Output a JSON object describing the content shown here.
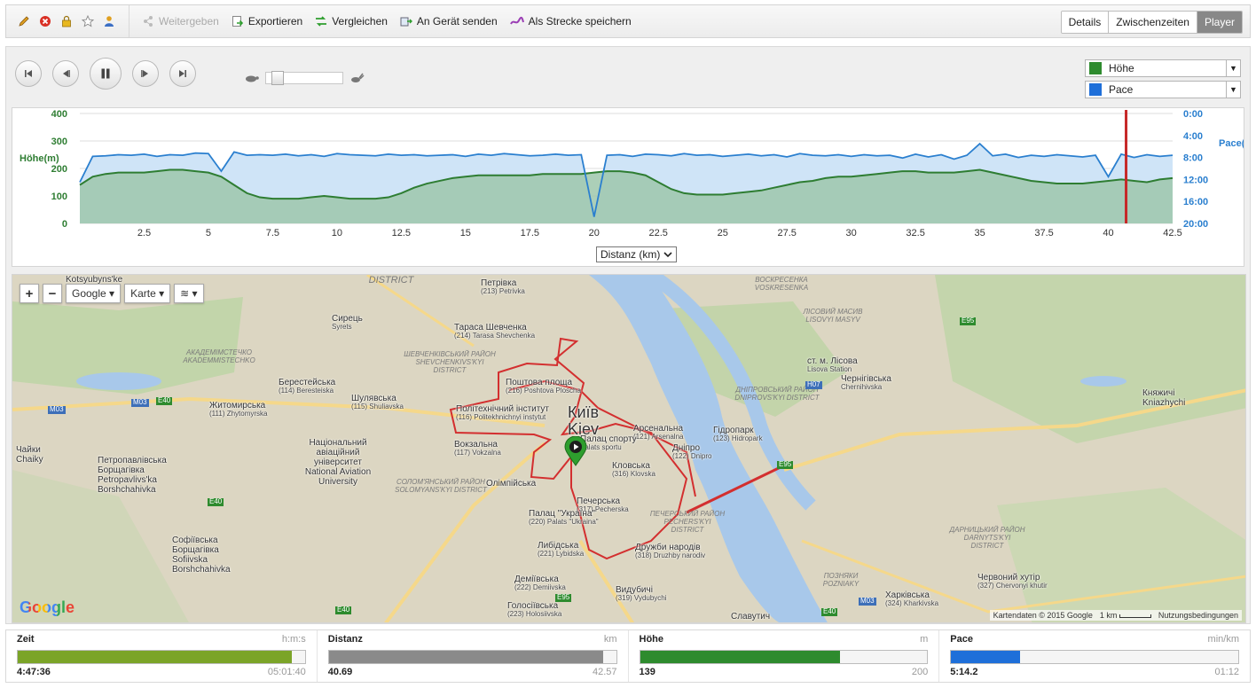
{
  "toolbar": {
    "icons": [
      "pencil-icon",
      "delete-icon",
      "lock-icon",
      "star-icon",
      "person-icon"
    ],
    "actions": [
      {
        "label": "Weitergeben",
        "icon": "share-icon",
        "enabled": false
      },
      {
        "label": "Exportieren",
        "icon": "export-icon",
        "enabled": true
      },
      {
        "label": "Vergleichen",
        "icon": "compare-icon",
        "enabled": true
      },
      {
        "label": "An Gerät senden",
        "icon": "send-device-icon",
        "enabled": true
      },
      {
        "label": "Als Strecke speichern",
        "icon": "save-course-icon",
        "enabled": true
      }
    ],
    "views": [
      {
        "label": "Details",
        "active": false
      },
      {
        "label": "Zwischenzeiten",
        "active": false
      },
      {
        "label": "Player",
        "active": true
      }
    ]
  },
  "player": {
    "buttons": [
      "skip-start-icon",
      "step-back-icon",
      "pause-icon",
      "step-forward-icon",
      "skip-end-icon"
    ],
    "speed_slow_icon": "turtle-icon",
    "speed_fast_icon": "rabbit-icon"
  },
  "series_selects": [
    {
      "label": "Höhe",
      "color": "#2e8b2e"
    },
    {
      "label": "Pace",
      "color": "#1e6fd9"
    }
  ],
  "chart_data": {
    "type": "area",
    "x": [
      0,
      0.5,
      1,
      1.5,
      2,
      2.5,
      3,
      3.5,
      4,
      4.5,
      5,
      5.5,
      6,
      6.5,
      7,
      7.5,
      8,
      8.5,
      9,
      9.5,
      10,
      10.5,
      11,
      11.5,
      12,
      12.5,
      13,
      13.5,
      14,
      14.5,
      15,
      15.5,
      16,
      16.5,
      17,
      17.5,
      18,
      18.5,
      19,
      19.5,
      20,
      20.5,
      21,
      21.5,
      22,
      22.5,
      23,
      23.5,
      24,
      24.5,
      25,
      25.5,
      26,
      26.5,
      27,
      27.5,
      28,
      28.5,
      29,
      29.5,
      30,
      30.5,
      31,
      31.5,
      32,
      32.5,
      33,
      33.5,
      34,
      34.5,
      35,
      35.5,
      36,
      36.5,
      37,
      37.5,
      38,
      38.5,
      39,
      39.5,
      40,
      40.5,
      41,
      41.5,
      42,
      42.5
    ],
    "xlim": [
      0,
      42.5
    ],
    "xticks": [
      "2.5",
      "5",
      "7.5",
      "10",
      "12.5",
      "15",
      "17.5",
      "20",
      "22.5",
      "25",
      "27.5",
      "30",
      "32.5",
      "35",
      "37.5",
      "40",
      "42.5"
    ],
    "xlabel": "Distanz (km)",
    "left_axis": {
      "label": "Höhe(m)",
      "ylim": [
        0,
        400
      ],
      "ticks": [
        "0",
        "100",
        "200",
        "300",
        "400"
      ]
    },
    "right_axis": {
      "label": "Pace(",
      "ticks": [
        "0:00",
        "4:00",
        "8:00",
        "12:00",
        "16:00",
        "20:00"
      ],
      "ylim": [
        0,
        20
      ]
    },
    "series": [
      {
        "name": "Höhe",
        "color": "#2e7d32",
        "fill": "#9dc7ab",
        "axis": "left",
        "values": [
          140,
          170,
          180,
          185,
          185,
          185,
          190,
          195,
          195,
          190,
          185,
          170,
          140,
          110,
          95,
          90,
          90,
          90,
          95,
          100,
          95,
          90,
          90,
          90,
          95,
          110,
          130,
          145,
          155,
          165,
          170,
          175,
          175,
          175,
          175,
          175,
          180,
          180,
          180,
          180,
          185,
          190,
          190,
          185,
          175,
          150,
          125,
          110,
          105,
          105,
          105,
          110,
          115,
          120,
          130,
          140,
          150,
          155,
          165,
          170,
          170,
          175,
          180,
          185,
          190,
          190,
          185,
          185,
          185,
          190,
          195,
          185,
          175,
          165,
          155,
          150,
          145,
          145,
          145,
          150,
          155,
          160,
          155,
          150,
          160,
          165
        ]
      },
      {
        "name": "Pace",
        "color": "#2a7fcf",
        "fill": "#cfe4f7",
        "axis": "right",
        "values": [
          12.5,
          7.8,
          7.7,
          7.5,
          7.6,
          7.4,
          7.8,
          7.5,
          7.6,
          7.2,
          7.3,
          10.5,
          7.0,
          7.6,
          7.5,
          7.6,
          7.4,
          7.7,
          7.5,
          7.8,
          7.3,
          7.5,
          7.6,
          7.7,
          7.4,
          7.6,
          7.5,
          7.7,
          7.6,
          7.5,
          7.8,
          7.4,
          7.6,
          7.3,
          7.5,
          7.7,
          7.6,
          7.4,
          7.6,
          7.5,
          18.8,
          7.6,
          7.5,
          7.8,
          7.4,
          7.5,
          7.7,
          7.3,
          7.6,
          7.5,
          7.8,
          7.6,
          7.4,
          7.7,
          7.5,
          7.9,
          7.3,
          7.6,
          7.7,
          7.5,
          7.8,
          7.5,
          7.7,
          7.6,
          8.1,
          7.4,
          7.9,
          7.5,
          8.3,
          7.6,
          5.5,
          7.7,
          7.4,
          8.0,
          7.6,
          7.8,
          7.5,
          7.7,
          7.9,
          7.6,
          11.5,
          7.4,
          8.0,
          7.5,
          7.8,
          7.6
        ]
      }
    ],
    "cursor_x": 40.69,
    "cursor_color": "#c62828"
  },
  "chart_ui": {
    "distance_select": "Distanz (km)"
  },
  "map": {
    "controls": {
      "zoom_in": "+",
      "zoom_out": "−",
      "provider": "Google",
      "type": "Karte",
      "layers_icon": "layers-icon"
    },
    "labels": [
      {
        "name": "Петрівка",
        "sub": "(213) Petrivka"
      },
      {
        "name": "Сирець",
        "sub": "Syrets"
      },
      {
        "name": "Тараса Шевченка",
        "sub": "(214) Tarasa Shevchenka"
      },
      {
        "name": "Поштова площа",
        "sub": "(216) Poshtova Ploscha"
      },
      {
        "name": "Берестейська",
        "sub": "(114) Beresteiska"
      },
      {
        "name": "Шулявська",
        "sub": "(115) Shuliavska"
      },
      {
        "name": "Політехнічний інститут",
        "sub": "(116) Politekhnichnyi instytut"
      },
      {
        "name": "Житомирська",
        "sub": "(111) Zhytomyrska"
      },
      {
        "name": "Київ",
        "sub": "Kiev"
      },
      {
        "name": "Арсенальна",
        "sub": "(121) Arsenalna"
      },
      {
        "name": "Гідропарк",
        "sub": "(123) Hidropark"
      },
      {
        "name": "Дніпро",
        "sub": "(122) Dnipro"
      },
      {
        "name": "Палац спорту",
        "sub": "Palats sportu"
      },
      {
        "name": "Кловська",
        "sub": "(316) Klovska"
      },
      {
        "name": "Вокзальна",
        "sub": "(117) Vokzalna"
      },
      {
        "name": "Олімпійська",
        "sub": ""
      },
      {
        "name": "Печерська",
        "sub": "(317) Pecherska"
      },
      {
        "name": "Палац \"Україна\"",
        "sub": "(220) Palats \"Ukraina\""
      },
      {
        "name": "Либідська",
        "sub": "(221) Lybidska"
      },
      {
        "name": "Дружби народів",
        "sub": "(318) Druzhby narodiv"
      },
      {
        "name": "Деміївська",
        "sub": "(222) Demiivska"
      },
      {
        "name": "Голосіївська",
        "sub": "(223) Holosiivska"
      },
      {
        "name": "Видубичі",
        "sub": "(319) Vydubychi"
      },
      {
        "name": "Славутич",
        "sub": ""
      },
      {
        "name": "Національний авіаційний університет",
        "sub": "National Aviation University"
      },
      {
        "name": "Петропавлівська Борщагівка",
        "sub": "Petropavlivs'ka Borshchahivka"
      },
      {
        "name": "Софіївська Борщагівка",
        "sub": "Sofiivska Borshchahivka"
      },
      {
        "name": "Чайки",
        "sub": "Chaiky"
      },
      {
        "name": "ст. м. Лісова",
        "sub": "Lisova Station"
      },
      {
        "name": "Чернігівська",
        "sub": "Chernihivska"
      },
      {
        "name": "Княжичі",
        "sub": "Kniazhychi"
      },
      {
        "name": "Червоний хутір",
        "sub": "(327) Chervonyi khutir"
      },
      {
        "name": "Харківська",
        "sub": "(324) Kharkivska"
      },
      {
        "name": "Kotsyubyns'ke",
        "sub": ""
      }
    ],
    "districts": [
      "ШЕВЧЕНКІВСЬКИЙ РАЙОН SHEVCHENKIVS'KYI DISTRICT",
      "СОЛОМ'ЯНСЬКИЙ РАЙОН SOLOMYANS'KYI DISTRICT",
      "ПЕЧЕРСЬКИЙ РАЙОН PECHERS'KYI DISTRICT",
      "ДНІПРОВСЬКИЙ РАЙОН DNIPROVS'KYI DISTRICT",
      "ЛІСОВИЙ МАСИВ LISOVYI MASYV",
      "ВОСКРЕСЕНКА VOSKRESENKA",
      "ДАРНИЦЬКИЙ РАЙОН DARNYTS'KYI DISTRICT",
      "ПОЗНЯКИ POZNIAKY",
      "АКАДЕМІМСТЕЧКО AKADEMMISTECHKO",
      "DISTRICT"
    ],
    "road_badges": [
      "M03",
      "M03",
      "E40",
      "E40",
      "E40",
      "E95",
      "E95",
      "E95",
      "H07",
      "M03",
      "E40"
    ],
    "logo": "Google",
    "footer": {
      "attribution": "Kartendaten © 2015 Google",
      "scale": "1 km",
      "terms": "Nutzungsbedingungen"
    }
  },
  "stats": [
    {
      "title": "Zeit",
      "unit": "h:m:s",
      "current": "4:47:36",
      "max": "05:01:40",
      "fraction": 0.954,
      "color": "#7ba428"
    },
    {
      "title": "Distanz",
      "unit": "km",
      "current": "40.69",
      "max": "42.57",
      "fraction": 0.956,
      "color": "#8a8a8a"
    },
    {
      "title": "Höhe",
      "unit": "m",
      "current": "139",
      "max": "200",
      "fraction": 0.695,
      "color": "#2e8b2e"
    },
    {
      "title": "Pace",
      "unit": "min/km",
      "current": "5:14.2",
      "max": "01:12",
      "fraction": 0.24,
      "color": "#1e6fd9"
    }
  ]
}
